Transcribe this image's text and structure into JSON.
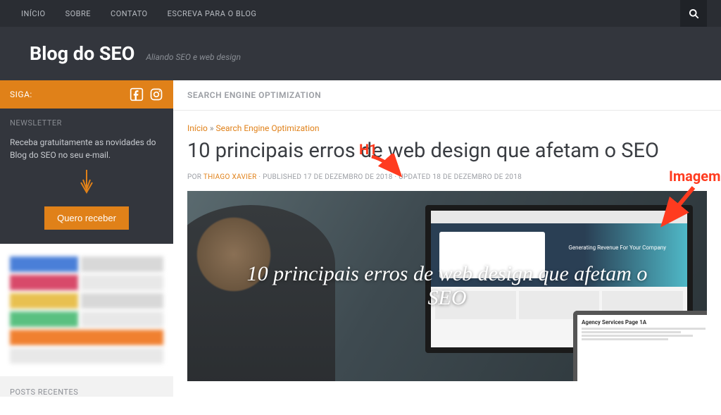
{
  "topnav": {
    "items": [
      "INÍCIO",
      "SOBRE",
      "CONTATO",
      "ESCREVA PARA O BLOG"
    ]
  },
  "header": {
    "title": "Blog do SEO",
    "tagline": "Aliando SEO e web design"
  },
  "sidebar": {
    "follow_label": "SIGA:",
    "newsletter": {
      "heading": "NEWSLETTER",
      "text": "Receba gratuitamente as novidades do Blog do SEO no seu e-mail.",
      "button": "Quero receber"
    },
    "recent_heading": "POSTS RECENTES"
  },
  "main": {
    "category": "SEARCH ENGINE OPTIMIZATION",
    "breadcrumb": {
      "home": "Início",
      "sep": " » ",
      "current": "Search Engine Optimization"
    },
    "h1": "10 principais erros de web design que afetam o SEO",
    "meta": {
      "by": "POR ",
      "author": "THIAGO XAVIER",
      "published": " · PUBLISHED 17 DE DEZEMBRO DE 2018 · UPDATED 18 DE DEZEMBRO DE 2018"
    },
    "hero_text": "10 principais erros de web design que afetam o SEO",
    "monitor": {
      "headline1": "Generating Revenue For Your Company"
    },
    "laptop": {
      "title": "Agency Services Page 1A"
    }
  },
  "annotations": {
    "h1": "H1",
    "image": "Imagem"
  }
}
